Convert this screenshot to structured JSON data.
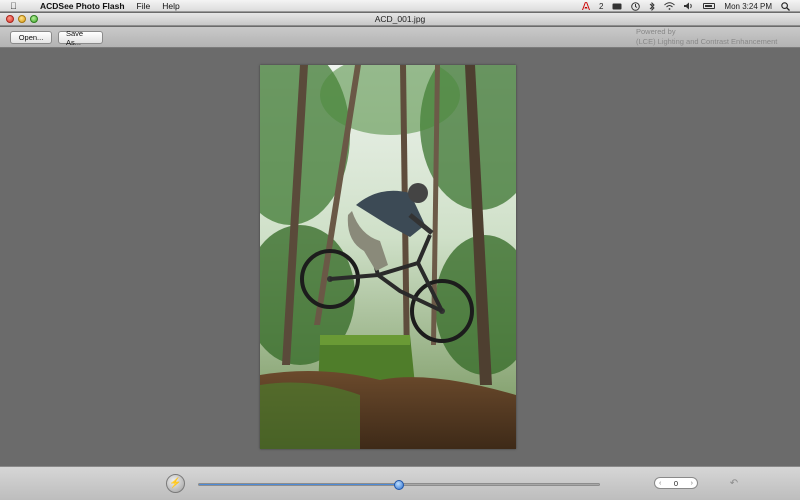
{
  "menubar": {
    "app_name": "ACDSee Photo Flash",
    "items": [
      "File",
      "Help"
    ],
    "right": {
      "notifications": "2",
      "clock": "Mon 3:24 PM"
    }
  },
  "window": {
    "title": "ACD_001.jpg"
  },
  "toolbar": {
    "open_label": "Open...",
    "save_label": "Save As...",
    "powered_line1": "Powered by",
    "powered_line2": "(LCE) Lighting and Contrast Enhancement"
  },
  "photo": {
    "subject_icon": "mountain-bike-jump-photo"
  },
  "bottom": {
    "slider_value_fraction": 0.5,
    "stepper_value": "0",
    "accent": "#2f6fc6"
  }
}
